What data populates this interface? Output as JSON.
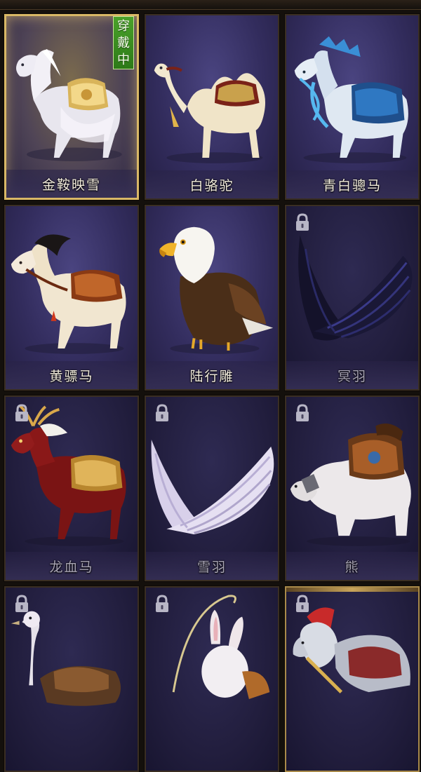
{
  "badge": {
    "wearing": "穿戴中"
  },
  "mounts": [
    {
      "name": "金鞍映雪",
      "icon": "white-horse-golden-saddle",
      "locked": false,
      "selected": true
    },
    {
      "name": "白骆驼",
      "icon": "white-camel",
      "locked": false,
      "selected": false
    },
    {
      "name": "青白骢马",
      "icon": "armored-blue-horse",
      "locked": false,
      "selected": false
    },
    {
      "name": "黄骠马",
      "icon": "tan-horse",
      "locked": false,
      "selected": false
    },
    {
      "name": "陆行雕",
      "icon": "eagle",
      "locked": false,
      "selected": false
    },
    {
      "name": "冥羽",
      "icon": "dark-wings",
      "locked": true,
      "selected": false
    },
    {
      "name": "龙血马",
      "icon": "red-antlered-horse",
      "locked": true,
      "selected": false
    },
    {
      "name": "雪羽",
      "icon": "white-wings",
      "locked": true,
      "selected": false
    },
    {
      "name": "熊",
      "icon": "armored-polar-bear",
      "locked": true,
      "selected": false
    },
    {
      "name": "",
      "icon": "ostrich",
      "locked": true,
      "selected": false
    },
    {
      "name": "",
      "icon": "rabbit",
      "locked": true,
      "selected": false
    },
    {
      "name": "",
      "icon": "armored-warhorse",
      "locked": true,
      "selected": false
    }
  ]
}
